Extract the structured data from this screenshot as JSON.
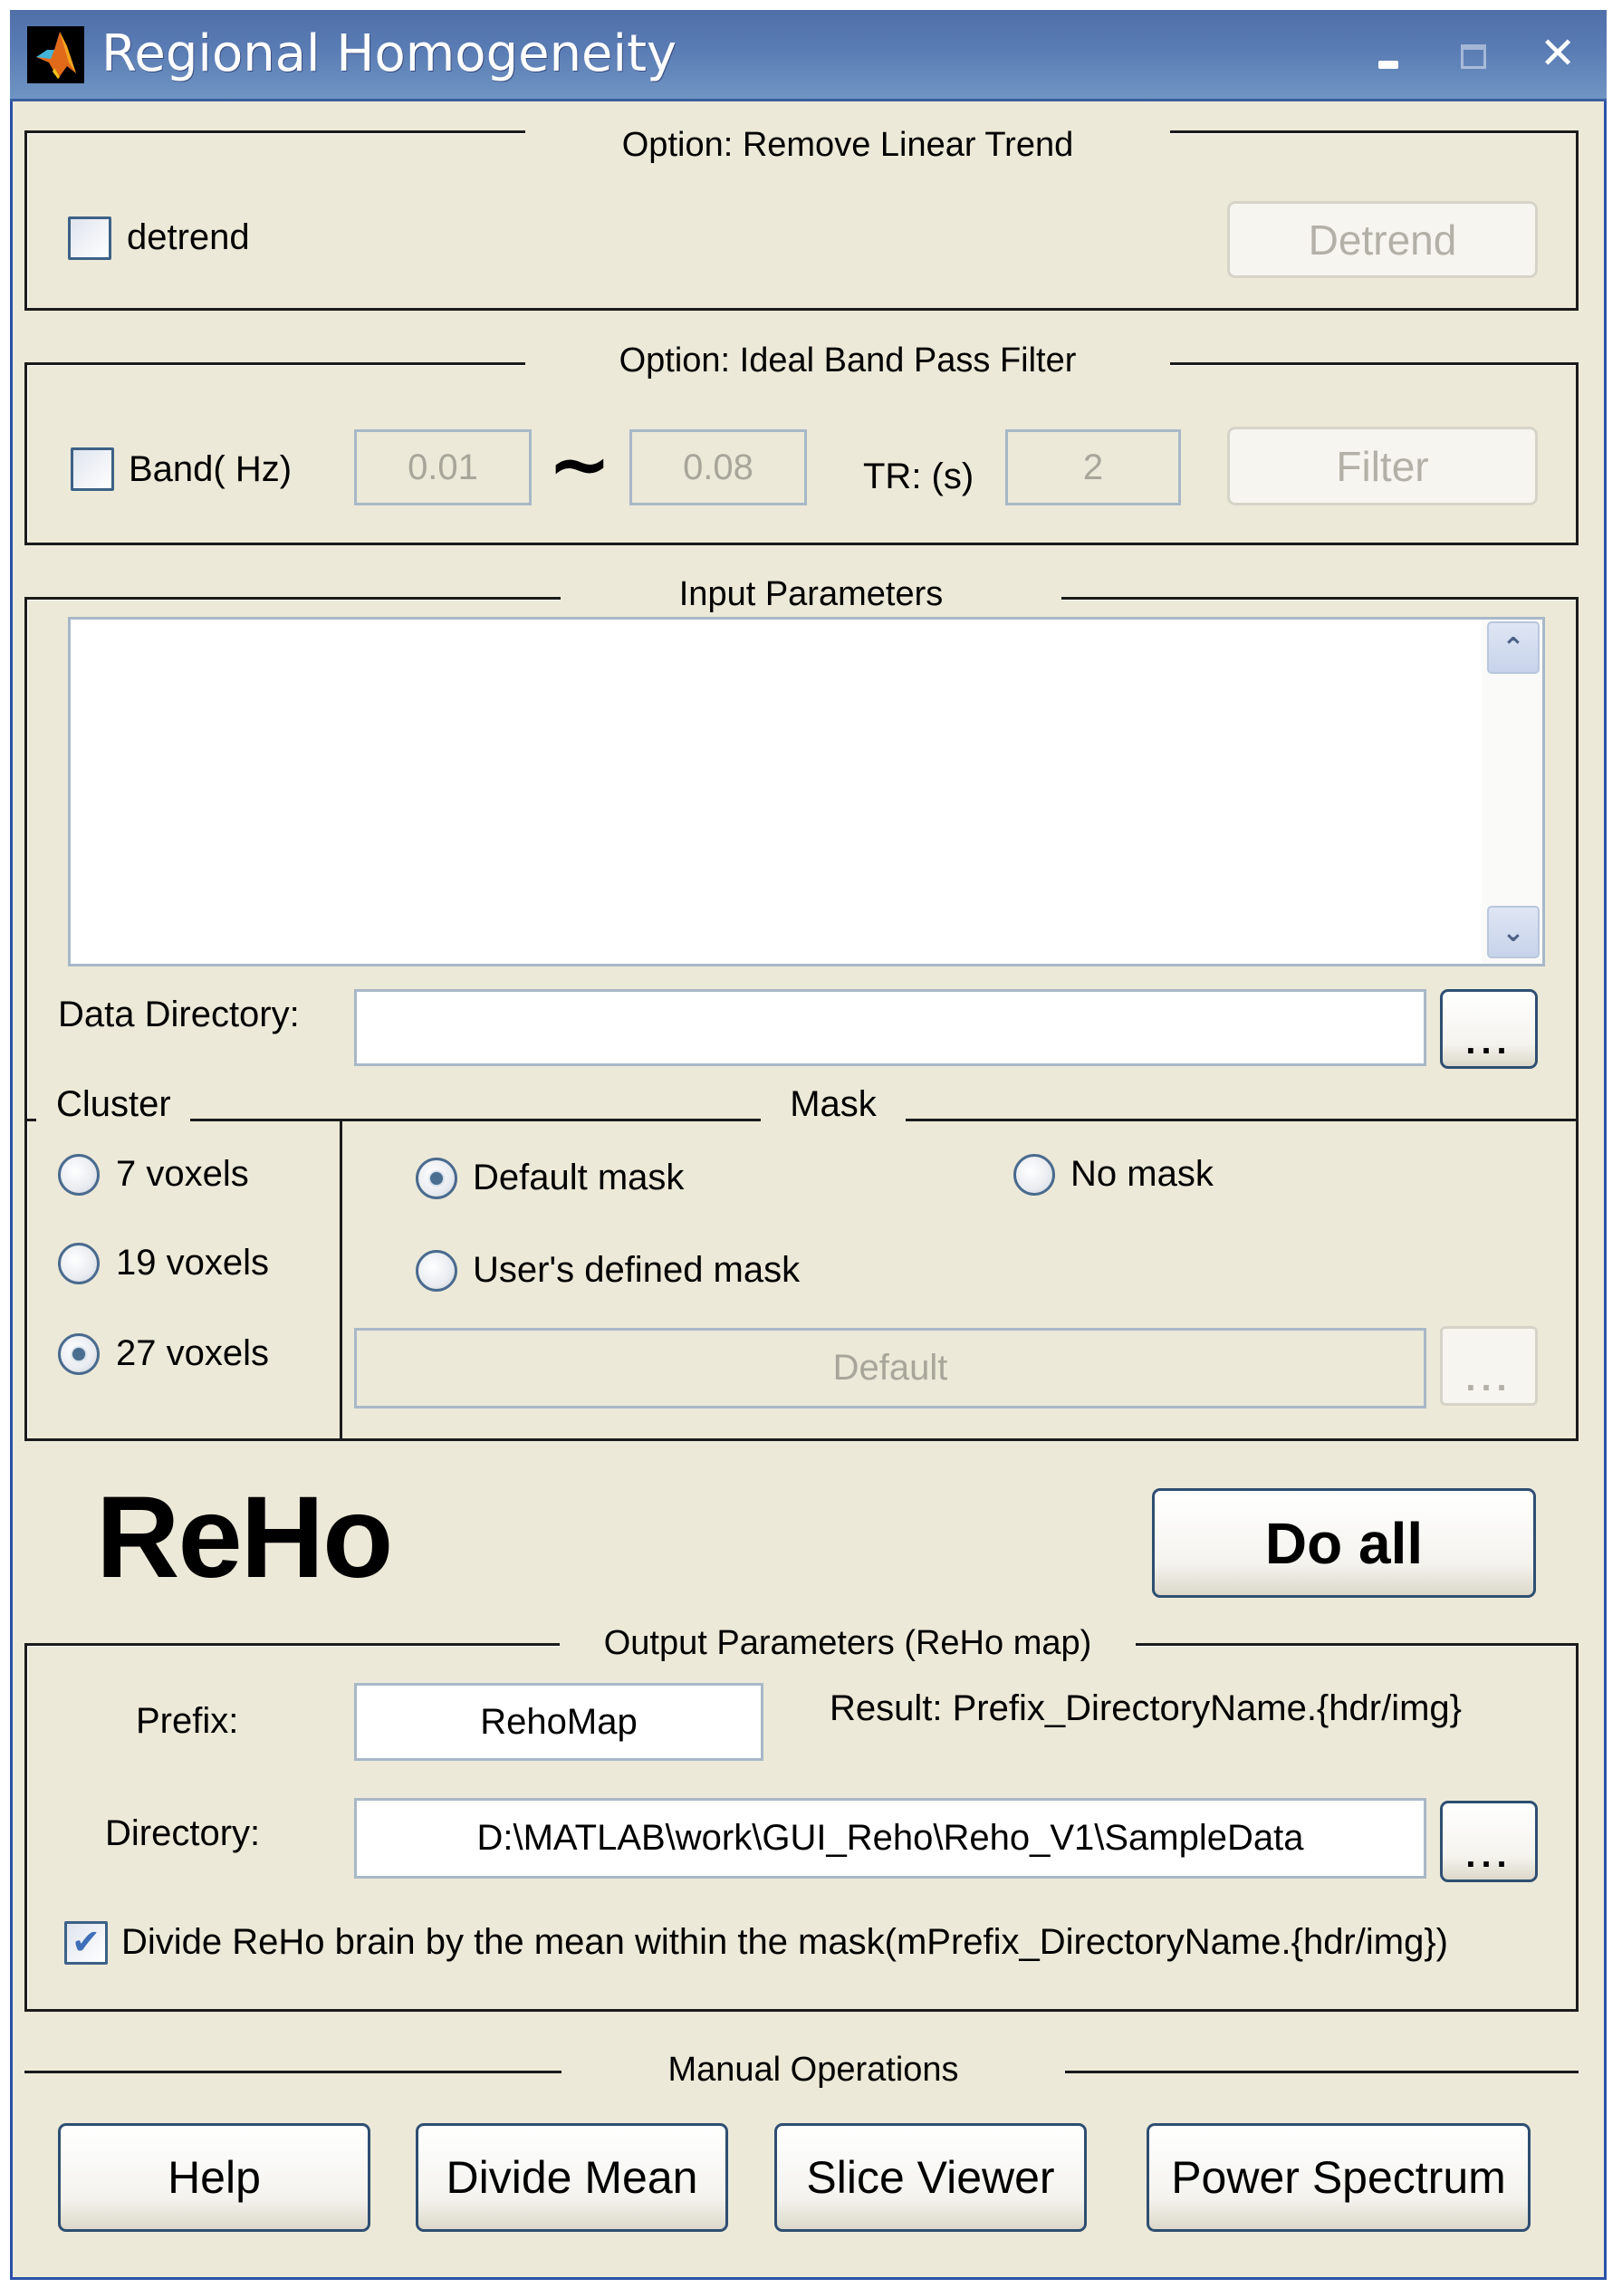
{
  "window": {
    "title": "Regional Homogeneity",
    "controls": {
      "minimize": "minimize",
      "maximize": "maximize",
      "close": "✕"
    }
  },
  "detrend_group": {
    "title": "Option: Remove Linear Trend",
    "checkbox_label": "detrend",
    "checked": false,
    "button_label": "Detrend",
    "button_enabled": false
  },
  "filter_group": {
    "title": "Option: Ideal Band Pass Filter",
    "checkbox_label": "Band( Hz)",
    "checked": false,
    "low_value": "0.01",
    "separator": "~",
    "high_value": "0.08",
    "tr_label": "TR: (s)",
    "tr_value": "2",
    "button_label": "Filter",
    "button_enabled": false
  },
  "input_group": {
    "title": "Input Parameters",
    "listbox_items": [],
    "data_directory_label": "Data Directory:",
    "data_directory_value": "",
    "browse_label": "...",
    "cluster": {
      "title": "Cluster",
      "options": [
        {
          "label": "7 voxels",
          "selected": false
        },
        {
          "label": "19 voxels",
          "selected": false
        },
        {
          "label": "27 voxels",
          "selected": true
        }
      ]
    },
    "mask": {
      "title": "Mask",
      "options": [
        {
          "label": "Default mask",
          "selected": true
        },
        {
          "label": "No mask",
          "selected": false
        },
        {
          "label": "User's defined mask",
          "selected": false
        }
      ],
      "mask_path_value": "Default",
      "browse_label": "..."
    }
  },
  "main": {
    "heading": "ReHo",
    "do_all_label": "Do all"
  },
  "output_group": {
    "title": "Output Parameters (ReHo map)",
    "prefix_label": "Prefix:",
    "prefix_value": "RehoMap",
    "result_text": "Result: Prefix_DirectoryName.{hdr/img}",
    "directory_label": "Directory:",
    "directory_value": "D:\\MATLAB\\work\\GUI_Reho\\Reho_V1\\SampleData",
    "browse_label": "...",
    "divide_checkbox_label": "Divide ReHo brain by the mean within the mask(mPrefix_DirectoryName.{hdr/img})",
    "divide_checked": true
  },
  "manual_operations": {
    "title": "Manual Operations",
    "buttons": [
      {
        "label": "Help"
      },
      {
        "label": "Divide Mean"
      },
      {
        "label": "Slice Viewer"
      },
      {
        "label": "Power Spectrum"
      }
    ]
  },
  "colors": {
    "titlebar": "#5a7cb4",
    "panel_bg": "#ece9d8",
    "frame_line": "#1b1b1b",
    "disabled_text": "#a8a69a"
  }
}
